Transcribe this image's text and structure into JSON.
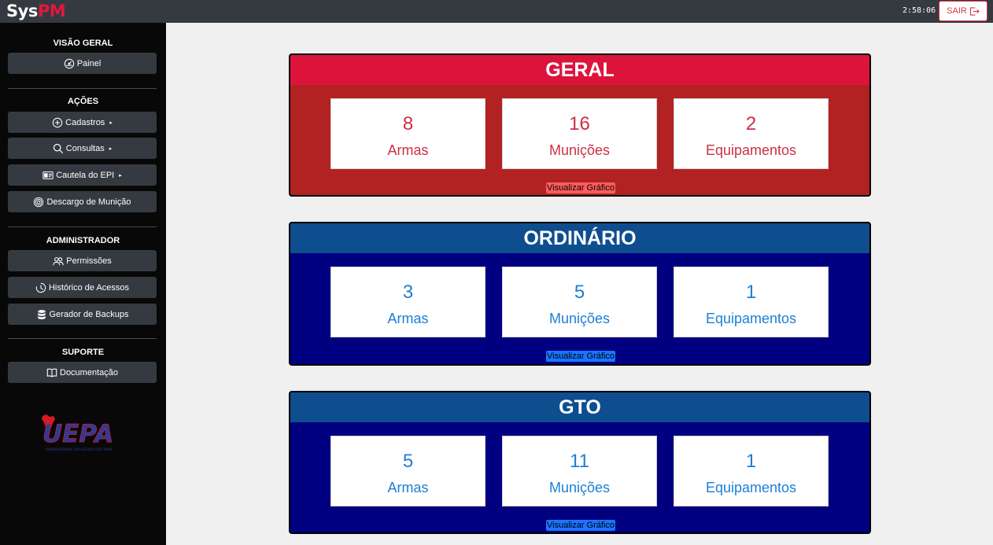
{
  "header": {
    "logo_sys": "Sys",
    "logo_pm": "PM",
    "clock": "2:58:06",
    "logout_label": "SAIR"
  },
  "sidebar": {
    "sections": {
      "overview": "VISÃO GERAL",
      "actions": "AÇÕES",
      "admin": "ADMINISTRADOR",
      "support": "SUPORTE"
    },
    "items": {
      "painel": "Painel",
      "cadastros": "Cadastros",
      "consultas": "Consultas",
      "cautela": "Cautela do EPI",
      "descargo": "Descargo de Munição",
      "permissoes": "Permissões",
      "historico": "Histórico de Acessos",
      "backups": "Gerador de Backups",
      "documentacao": "Documentação"
    },
    "caret": "▸",
    "logo_text": "UEPA",
    "logo_subtitle": "UNIVERSIDADE DO ESTADO DO PARÁ"
  },
  "panels": [
    {
      "title": "GERAL",
      "theme": "red",
      "cards": [
        {
          "value": "8",
          "label": "Armas"
        },
        {
          "value": "16",
          "label": "Munições"
        },
        {
          "value": "2",
          "label": "Equipamentos"
        }
      ],
      "chart_link": "Visualizar Gráfico"
    },
    {
      "title": "ORDINÁRIO",
      "theme": "blue",
      "cards": [
        {
          "value": "3",
          "label": "Armas"
        },
        {
          "value": "5",
          "label": "Munições"
        },
        {
          "value": "1",
          "label": "Equipamentos"
        }
      ],
      "chart_link": "Visualizar Gráfico"
    },
    {
      "title": "GTO",
      "theme": "blue",
      "cards": [
        {
          "value": "5",
          "label": "Armas"
        },
        {
          "value": "11",
          "label": "Munições"
        },
        {
          "value": "1",
          "label": "Equipamentos"
        }
      ],
      "chart_link": "Visualizar Gráfico"
    }
  ],
  "colors": {
    "brand_red": "#e4163f",
    "geral_header": "#dc143c",
    "geral_body": "#b22222",
    "blue_header": "#0e4e8f",
    "blue_body": "#000080"
  }
}
